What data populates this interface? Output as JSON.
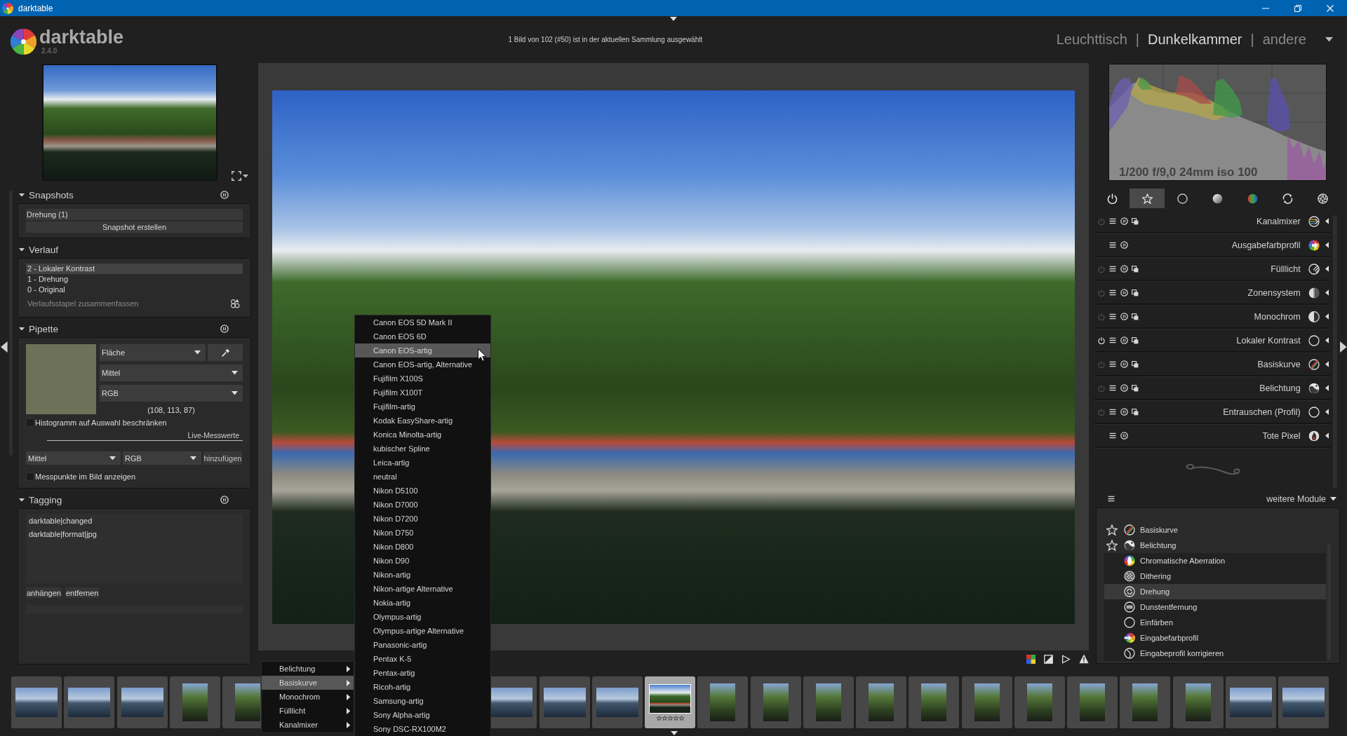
{
  "window": {
    "title": "darktable"
  },
  "app": {
    "name": "darktable",
    "version": "2.4.0"
  },
  "header": {
    "status": "1 Bild von 102 (#50) ist in der aktuellen Sammlung ausgewählt",
    "separator": "|",
    "views": [
      {
        "label": "Leuchttisch",
        "selected": false
      },
      {
        "label": "Dunkelkammer",
        "selected": true
      },
      {
        "label": "andere",
        "selected": false
      }
    ]
  },
  "left_panel": {
    "snapshots": {
      "title": "Snapshots",
      "items": [
        {
          "label": "Drehung (1)"
        }
      ],
      "button": "Snapshot erstellen"
    },
    "history": {
      "title": "Verlauf",
      "items": [
        {
          "label": "2 - Lokaler Kontrast",
          "selected": true
        },
        {
          "label": "1 - Drehung",
          "selected": false
        },
        {
          "label": "0 - Original",
          "selected": false
        }
      ],
      "compress": "Verlaufsstapel zusammenfassen"
    },
    "color_picker": {
      "title": "Pipette",
      "swatch": {
        "color": "#6c7157"
      },
      "area": "Fläche",
      "statistic": "Mittel",
      "model": "RGB",
      "reading": "(108, 113, 87)",
      "restrict_histogram": {
        "label": "Histogramm auf Auswahl beschränken",
        "checked": false
      },
      "live_section": "Live-Messwerte",
      "live_statistic": "Mittel",
      "live_model": "RGB",
      "add_button": "hinzufügen",
      "show_points": {
        "label": "Messpunkte im Bild anzeigen",
        "checked": false
      }
    },
    "tagging": {
      "title": "Tagging",
      "tags": [
        "darktable|changed",
        "darktable|format|jpg"
      ],
      "buttons": [
        "anhängen",
        "entfernen"
      ]
    }
  },
  "right_panel": {
    "histogram": {
      "exif": "1/200 f/9,0 24mm iso 100"
    },
    "module_groups": [
      {
        "selected": false
      },
      {
        "selected": true
      },
      {
        "selected": false
      },
      {
        "selected": false
      },
      {
        "selected": false
      },
      {
        "selected": false
      },
      {
        "selected": false
      }
    ],
    "modules": [
      {
        "label": "Kanalmixer",
        "kind": "switchable",
        "enabled": false
      },
      {
        "label": "Ausgabefarbprofil",
        "kind": "fixed"
      },
      {
        "label": "Fülllicht",
        "kind": "switchable",
        "enabled": false
      },
      {
        "label": "Zonensystem",
        "kind": "switchable",
        "enabled": false
      },
      {
        "label": "Monochrom",
        "kind": "switchable",
        "enabled": false
      },
      {
        "label": "Lokaler Kontrast",
        "kind": "switchable",
        "enabled": true
      },
      {
        "label": "Basiskurve",
        "kind": "switchable",
        "enabled": false
      },
      {
        "label": "Belichtung",
        "kind": "switchable",
        "enabled": false
      },
      {
        "label": "Entrauschen (Profil)",
        "kind": "switchable",
        "enabled": false
      },
      {
        "label": "Tote Pixel",
        "kind": "fixed"
      }
    ],
    "more_modules": {
      "label": "weitere Module",
      "items": [
        {
          "label": "Basiskurve",
          "favorite": true,
          "selected": false
        },
        {
          "label": "Belichtung",
          "favorite": true,
          "selected": false
        },
        {
          "label": "Chromatische Aberration",
          "favorite": false,
          "selected": false
        },
        {
          "label": "Dithering",
          "favorite": false,
          "selected": false
        },
        {
          "label": "Drehung",
          "favorite": false,
          "selected": true
        },
        {
          "label": "Dunstentfernung",
          "favorite": false,
          "selected": false
        },
        {
          "label": "Einfärben",
          "favorite": false,
          "selected": false
        },
        {
          "label": "Eingabefarbprofil",
          "favorite": false,
          "selected": false
        },
        {
          "label": "Eingabeprofil korrigieren",
          "favorite": false,
          "selected": false
        }
      ]
    }
  },
  "context_menu": {
    "items": [
      {
        "label": "Belichtung",
        "selected": false
      },
      {
        "label": "Basiskurve",
        "selected": true
      },
      {
        "label": "Monochrom",
        "selected": false
      },
      {
        "label": "Fülllicht",
        "selected": false
      },
      {
        "label": "Kanalmixer",
        "selected": false
      }
    ],
    "submenu": {
      "items": [
        {
          "label": "Canon EOS 5D Mark II",
          "selected": false
        },
        {
          "label": "Canon EOS 6D",
          "selected": false
        },
        {
          "label": "Canon EOS-artig",
          "selected": true
        },
        {
          "label": "Canon EOS-artig, Alternative",
          "selected": false
        },
        {
          "label": "Fujifilm X100S",
          "selected": false
        },
        {
          "label": "Fujifilm X100T",
          "selected": false
        },
        {
          "label": "Fujifilm-artig",
          "selected": false
        },
        {
          "label": "Kodak EasyShare-artig",
          "selected": false
        },
        {
          "label": "Konica Minolta-artig",
          "selected": false
        },
        {
          "label": "kubischer Spline",
          "selected": false
        },
        {
          "label": "Leica-artig",
          "selected": false
        },
        {
          "label": "neutral",
          "selected": false
        },
        {
          "label": "Nikon D5100",
          "selected": false
        },
        {
          "label": "Nikon D7000",
          "selected": false
        },
        {
          "label": "Nikon D7200",
          "selected": false
        },
        {
          "label": "Nikon D750",
          "selected": false
        },
        {
          "label": "Nikon D800",
          "selected": false
        },
        {
          "label": "Nikon D90",
          "selected": false
        },
        {
          "label": "Nikon-artig",
          "selected": false
        },
        {
          "label": "Nikon-artige Alternative",
          "selected": false
        },
        {
          "label": "Nokia-artig",
          "selected": false
        },
        {
          "label": "Olympus-artig",
          "selected": false
        },
        {
          "label": "Olympus-artige Alternative",
          "selected": false
        },
        {
          "label": "Panasonic-artig",
          "selected": false
        },
        {
          "label": "Pentax K-5",
          "selected": false
        },
        {
          "label": "Pentax-artig",
          "selected": false
        },
        {
          "label": "Ricoh-artig",
          "selected": false
        },
        {
          "label": "Samsung-artig",
          "selected": false
        },
        {
          "label": "Sony Alpha-artig",
          "selected": false
        },
        {
          "label": "Sony DSC-RX100M2",
          "selected": false
        }
      ]
    }
  },
  "filmstrip": {
    "left": [
      {
        "kind": "landscape",
        "selected": false
      },
      {
        "kind": "landscape",
        "selected": false
      },
      {
        "kind": "landscape",
        "selected": false
      },
      {
        "kind": "portrait",
        "selected": false
      },
      {
        "kind": "portrait",
        "selected": false
      }
    ],
    "right": [
      {
        "kind": "landscape",
        "selected": false
      },
      {
        "kind": "landscape",
        "selected": false
      },
      {
        "kind": "landscape",
        "selected": false
      },
      {
        "kind": "landscape",
        "selected": true,
        "stars": 0
      },
      {
        "kind": "portrait",
        "selected": false
      },
      {
        "kind": "portrait",
        "selected": false
      },
      {
        "kind": "portrait",
        "selected": false
      },
      {
        "kind": "portrait",
        "selected": false
      },
      {
        "kind": "portrait",
        "selected": false
      },
      {
        "kind": "portrait",
        "selected": false
      },
      {
        "kind": "portrait",
        "selected": false
      },
      {
        "kind": "portrait",
        "selected": false
      },
      {
        "kind": "portrait",
        "selected": false
      },
      {
        "kind": "portrait",
        "selected": false
      },
      {
        "kind": "landscape",
        "selected": false
      },
      {
        "kind": "landscape",
        "selected": false
      }
    ]
  }
}
